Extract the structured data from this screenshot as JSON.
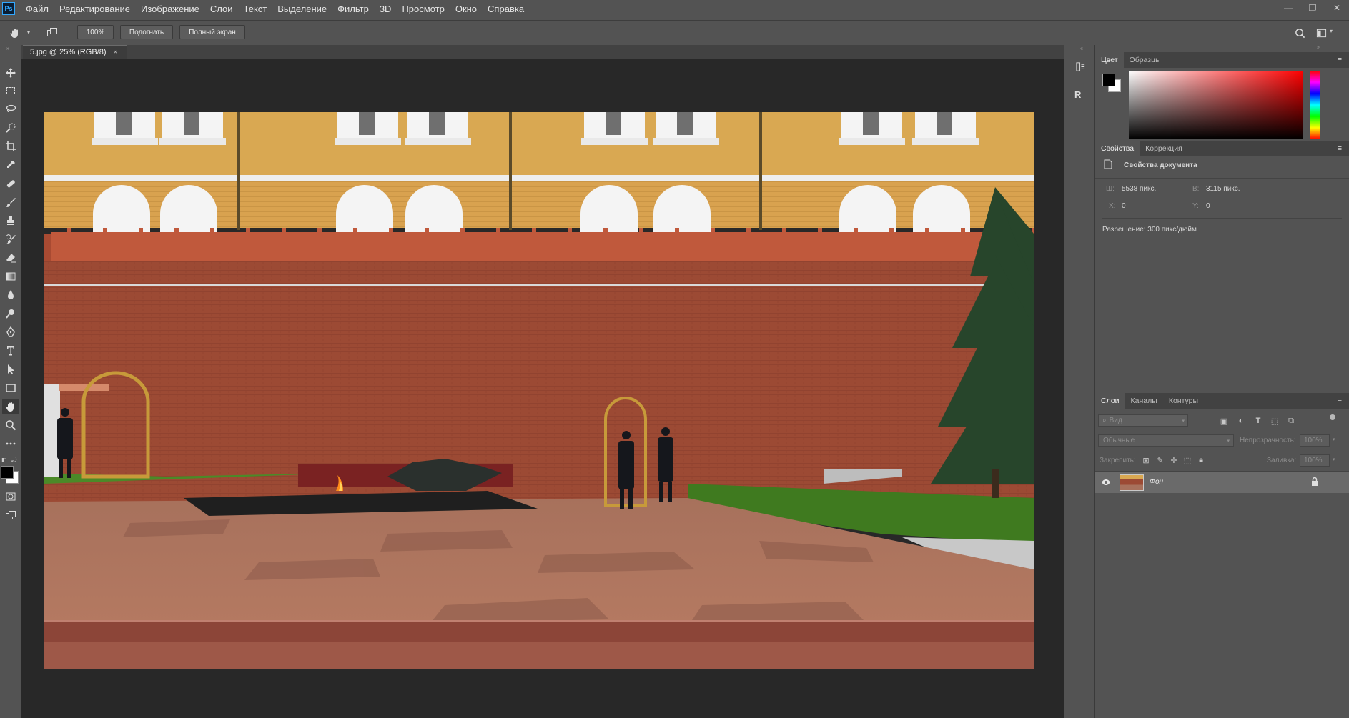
{
  "menubar": {
    "logo": "Ps",
    "items": [
      "Файл",
      "Редактирование",
      "Изображение",
      "Слои",
      "Текст",
      "Выделение",
      "Фильтр",
      "3D",
      "Просмотр",
      "Окно",
      "Справка"
    ]
  },
  "options": {
    "zoom_value": "100%",
    "fit_label": "Подогнать",
    "fullscreen_label": "Полный экран"
  },
  "document": {
    "tab_title": "5.jpg @ 25% (RGB/8)",
    "close": "×"
  },
  "side_strip": {
    "history_label": "",
    "r_label": "R"
  },
  "color_panel": {
    "tabs": [
      "Цвет",
      "Образцы"
    ]
  },
  "properties_panel": {
    "tabs": [
      "Свойства",
      "Коррекция"
    ],
    "header": "Свойства документа",
    "w_label": "Ш:",
    "w_value": "5538 пикс.",
    "h_label": "В:",
    "h_value": "3115 пикс.",
    "x_label": "X:",
    "x_value": "0",
    "y_label": "Y:",
    "y_value": "0",
    "resolution": "Разрешение: 300 пикс/дюйм"
  },
  "layers_panel": {
    "tabs": [
      "Слои",
      "Каналы",
      "Контуры"
    ],
    "search_placeholder": "Вид",
    "blend_mode": "Обычные",
    "opacity_label": "Непрозрачность:",
    "opacity_value": "100%",
    "lock_label": "Закрепить:",
    "fill_label": "Заливка:",
    "fill_value": "100%",
    "layer_name": "Фон"
  },
  "colors": {
    "accent": "#31a8ff",
    "background": "#535353",
    "canvas": "#282828",
    "panel_tabs": "#424242"
  }
}
